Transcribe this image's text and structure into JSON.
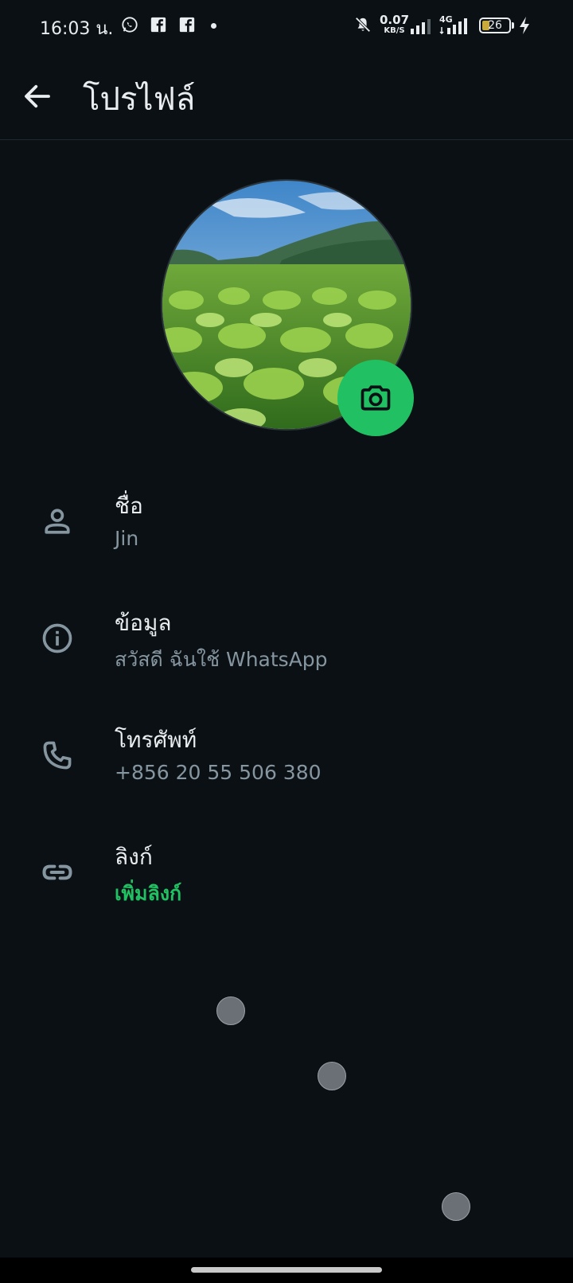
{
  "status_bar": {
    "time": "16:03 น.",
    "net_speed": "0.07",
    "net_unit": "KB/S",
    "network": "4G",
    "battery": "26"
  },
  "header": {
    "title": "โปรไฟล์"
  },
  "profile": {
    "name_label": "ชื่อ",
    "name_value": "Jin",
    "about_label": "ข้อมูล",
    "about_value": "สวัสดี ฉันใช้ WhatsApp",
    "phone_label": "โทรศัพท์",
    "phone_value": "+856 20 55 506 380",
    "links_label": "ลิงก์",
    "links_action": "เพิ่มลิงก์"
  },
  "colors": {
    "accent": "#21c063",
    "background": "#0b1014",
    "secondary_text": "#8696a0"
  },
  "icons": [
    "back-arrow-icon",
    "camera-icon",
    "person-icon",
    "info-icon",
    "phone-icon",
    "link-icon",
    "whatsapp-icon",
    "facebook-icon",
    "mute-icon",
    "signal-icon",
    "battery-icon",
    "charging-icon"
  ]
}
